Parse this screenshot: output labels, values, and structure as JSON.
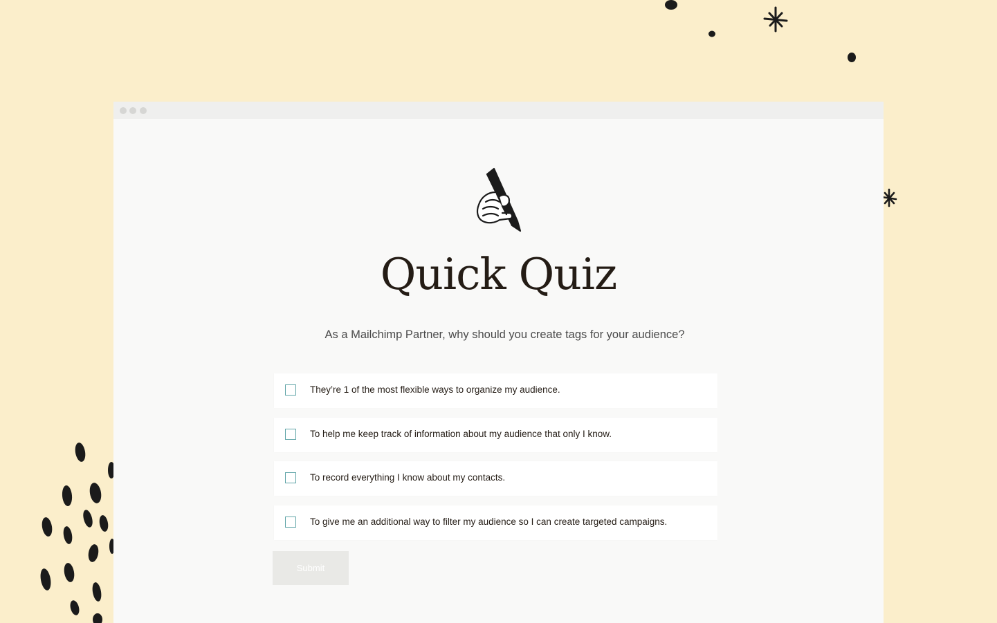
{
  "browser": {
    "dots": [
      "window-dot-1",
      "window-dot-2",
      "window-dot-3"
    ]
  },
  "quiz": {
    "illustration_icon": "hand-holding-pencil-icon",
    "title": "Quick Quiz",
    "question": "As a Mailchimp Partner, why should you create tags for your audience?",
    "options": [
      {
        "label": "They’re 1 of the most flexible ways to organize my audience.",
        "checked": false
      },
      {
        "label": "To help me keep track of information about my audience that only I know.",
        "checked": false
      },
      {
        "label": "To record everything I know about my contacts.",
        "checked": false
      },
      {
        "label": "To give me an additional way to filter my audience so I can create targeted campaigns.",
        "checked": false
      }
    ],
    "submit_label": "Submit",
    "submit_enabled": false
  },
  "colors": {
    "page_background": "#fbeecb",
    "card_background": "#f9f9f8",
    "checkbox_border": "#5fa4a7",
    "text_dark": "#241c15",
    "submit_disabled": "#e9e9e6"
  }
}
